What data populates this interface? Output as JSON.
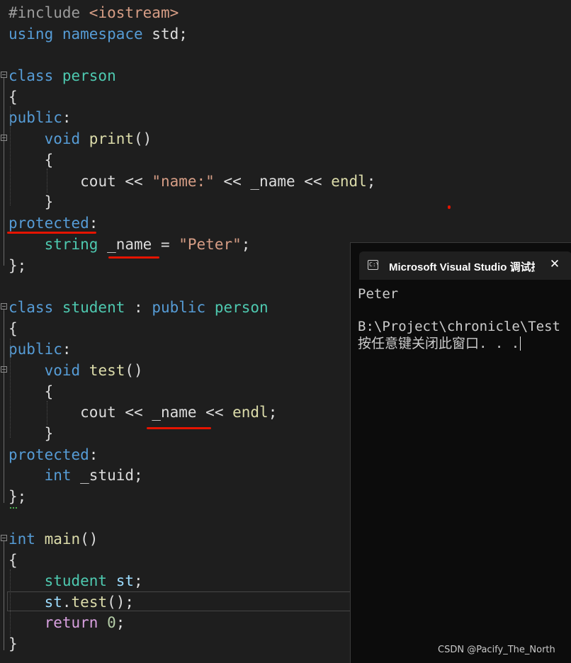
{
  "editor": {
    "lines": [
      [
        [
          "#include ",
          "p"
        ],
        [
          "<iostream>",
          "s"
        ]
      ],
      [
        [
          "using ",
          "k"
        ],
        [
          "namespace ",
          "k"
        ],
        [
          "std;",
          "d"
        ]
      ],
      [],
      [
        [
          "class ",
          "k"
        ],
        [
          "person",
          "c"
        ]
      ],
      [
        [
          "{",
          "d"
        ]
      ],
      [
        [
          "public",
          "k"
        ],
        [
          ":",
          "d"
        ]
      ],
      [
        [
          "    ",
          "d"
        ],
        [
          "void ",
          "k"
        ],
        [
          "print",
          "f"
        ],
        [
          "()",
          "d"
        ]
      ],
      [
        [
          "    {",
          "d"
        ]
      ],
      [
        [
          "        ",
          "d"
        ],
        [
          "cout",
          "d"
        ],
        [
          " << ",
          "d"
        ],
        [
          "\"name:\"",
          "s"
        ],
        [
          " << ",
          "d"
        ],
        [
          "_name",
          "d"
        ],
        [
          " << ",
          "d"
        ],
        [
          "endl",
          "f"
        ],
        [
          ";",
          "d"
        ]
      ],
      [
        [
          "    }",
          "d"
        ]
      ],
      [
        [
          "protected",
          "k"
        ],
        [
          ":",
          "d"
        ]
      ],
      [
        [
          "    ",
          "d"
        ],
        [
          "string ",
          "c"
        ],
        [
          "_name",
          "d"
        ],
        [
          " = ",
          "d"
        ],
        [
          "\"Peter\"",
          "s"
        ],
        [
          ";",
          "d"
        ]
      ],
      [
        [
          "};",
          "d"
        ]
      ],
      [],
      [
        [
          "class ",
          "k"
        ],
        [
          "student ",
          "c"
        ],
        [
          ": ",
          "d"
        ],
        [
          "public ",
          "k"
        ],
        [
          "person",
          "c"
        ]
      ],
      [
        [
          "{",
          "d"
        ]
      ],
      [
        [
          "public",
          "k"
        ],
        [
          ":",
          "d"
        ]
      ],
      [
        [
          "    ",
          "d"
        ],
        [
          "void ",
          "k"
        ],
        [
          "test",
          "f"
        ],
        [
          "()",
          "d"
        ]
      ],
      [
        [
          "    {",
          "d"
        ]
      ],
      [
        [
          "        ",
          "d"
        ],
        [
          "cout",
          "d"
        ],
        [
          " << ",
          "d"
        ],
        [
          "_name",
          "d"
        ],
        [
          " << ",
          "d"
        ],
        [
          "endl",
          "f"
        ],
        [
          ";",
          "d"
        ]
      ],
      [
        [
          "    }",
          "d"
        ]
      ],
      [
        [
          "protected",
          "k"
        ],
        [
          ":",
          "d"
        ]
      ],
      [
        [
          "    ",
          "d"
        ],
        [
          "int ",
          "k"
        ],
        [
          "_stuid;",
          "d"
        ]
      ],
      [
        [
          "};",
          "d"
        ]
      ],
      [],
      [
        [
          "int ",
          "k"
        ],
        [
          "main",
          "f"
        ],
        [
          "()",
          "d"
        ]
      ],
      [
        [
          "{",
          "d"
        ]
      ],
      [
        [
          "    ",
          "d"
        ],
        [
          "student ",
          "c"
        ],
        [
          "st",
          "m"
        ],
        [
          ";",
          "d"
        ]
      ],
      [
        [
          "    ",
          "d"
        ],
        [
          "st",
          "m"
        ],
        [
          ".",
          "d"
        ],
        [
          "test",
          "f"
        ],
        [
          "();",
          "d"
        ]
      ],
      [
        [
          "    ",
          "d"
        ],
        [
          "return ",
          "r"
        ],
        [
          "0",
          "n"
        ],
        [
          ";",
          "d"
        ]
      ],
      [
        [
          "}",
          "d"
        ]
      ]
    ]
  },
  "console": {
    "icon_text": "C:\\",
    "title": "Microsoft Visual Studio 调试控制台",
    "close_icon": "close-icon",
    "terminal_icon": "terminal-icon",
    "output": [
      "Peter",
      "",
      "B:\\Project\\chronicle\\Test",
      "按任意键关闭此窗口. . ."
    ]
  },
  "watermark": "CSDN @Pacify_The_North",
  "colors": {
    "background": "#1e1e1e",
    "keyword": "#569cd6",
    "type": "#4ec9b0",
    "function": "#dcdcaa",
    "string": "#d69d85",
    "preprocessor": "#9b9b9b",
    "local": "#9cdcfe",
    "control": "#d8a0df",
    "number": "#b5cea8",
    "annotation": "#e51400"
  }
}
